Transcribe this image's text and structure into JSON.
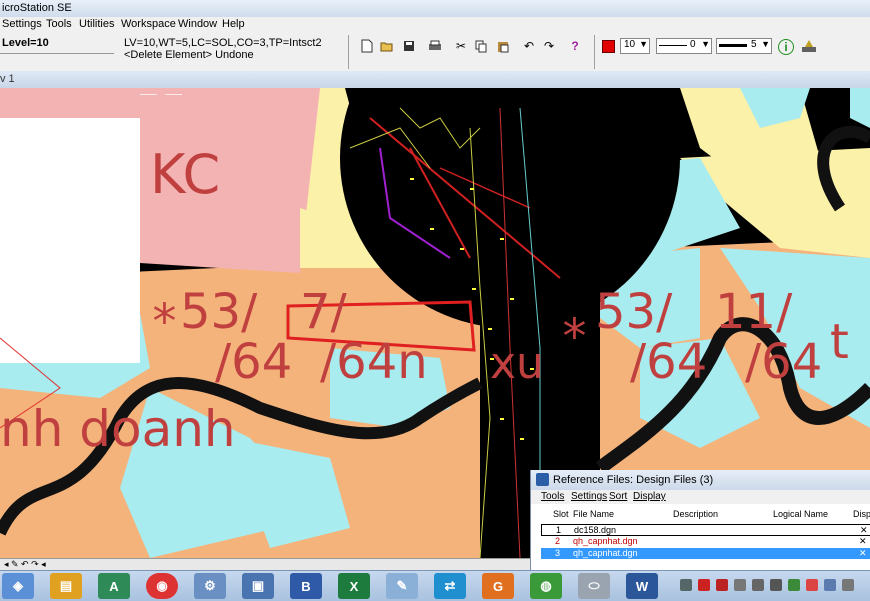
{
  "window": {
    "title": "icroStation SE"
  },
  "menu": [
    "Settings",
    "Tools",
    "Utilities",
    "Workspace",
    "Window",
    "Help"
  ],
  "status": {
    "level": "Level=10",
    "attributes": "LV=10,WT=5,LC=SOL,CO=3,TP=Intsct2",
    "prompt": "<Delete Element> Undone"
  },
  "attr_toolbar": {
    "level": "10",
    "style": "0",
    "weight": "5"
  },
  "view": {
    "label": "v 1"
  },
  "drawing": {
    "kc": "KC",
    "lot1_a": "53/",
    "lot1_b": "/64",
    "lot2_a": "7/",
    "lot2_b": "/64n",
    "xu": "xu",
    "lot3_a": "53/",
    "lot3_b": "/64",
    "lot4_a": "11/",
    "lot4_b": "/64",
    "t": "t",
    "kinh_doanh": "nh doanh"
  },
  "reference": {
    "title": "Reference Files: Design Files (3)",
    "menu": [
      "Tools",
      "Settings",
      "Sort",
      "Display"
    ],
    "columns": [
      "Slot",
      "File Name",
      "Description",
      "Logical Name",
      "Displ"
    ],
    "rows": [
      {
        "slot": "1",
        "file": "dc158.dgn"
      },
      {
        "slot": "2",
        "file": "qh_capnhat.dgn"
      },
      {
        "slot": "3",
        "file": "qh_capnhat.dgn"
      }
    ]
  },
  "icons": [
    "new-file-icon",
    "open-icon",
    "save-icon",
    "print-icon",
    "cut-icon",
    "copy-icon",
    "paste-icon",
    "undo-icon",
    "redo-icon",
    "help-icon",
    "info-icon",
    "level-manager-icon"
  ],
  "colors": {
    "accent_selected_row": "#3399ff",
    "pink_zone": "#f4b3b3",
    "orange_zone": "#f5b37c",
    "cyan_zone": "#a8ecef",
    "yellow_zone": "#fbf1a8",
    "lot_outline": "#e02020"
  }
}
